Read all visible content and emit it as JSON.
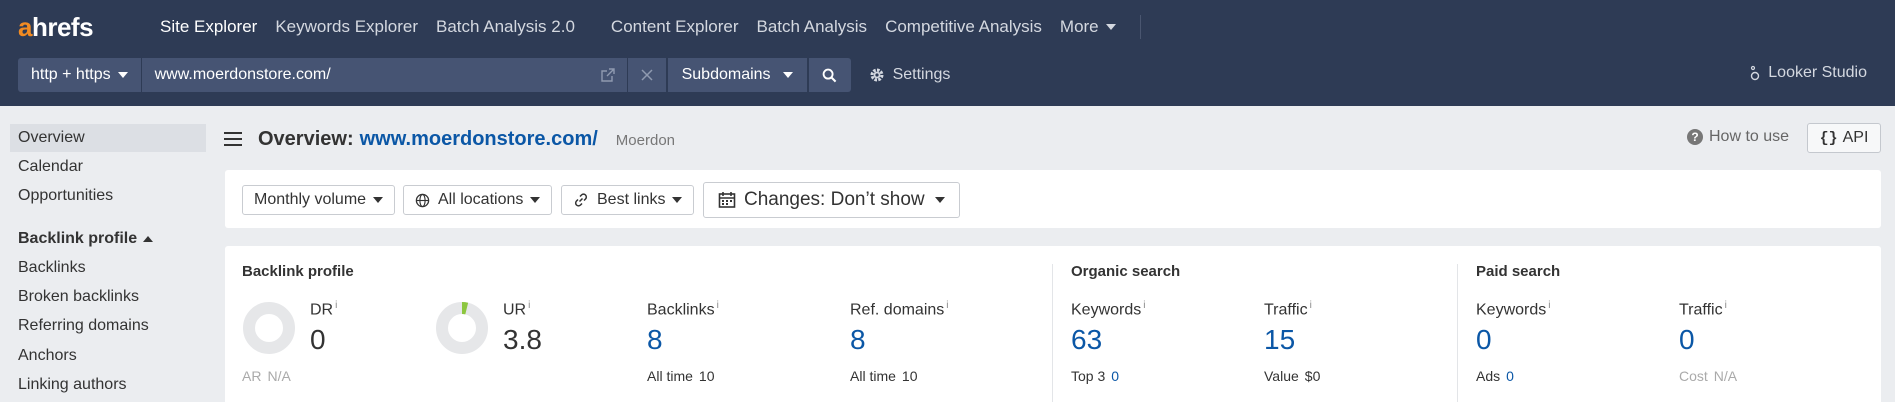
{
  "logo": {
    "a": "a",
    "rest": "hrefs"
  },
  "nav": {
    "items": [
      "Site Explorer",
      "Keywords Explorer",
      "Batch Analysis 2.0",
      "Content Explorer",
      "Batch Analysis",
      "Competitive Analysis"
    ],
    "more": "More"
  },
  "search": {
    "protocol": "http + https",
    "url": "www.moerdonstore.com/",
    "mode": "Subdomains",
    "settings": "Settings"
  },
  "looker": "Looker Studio",
  "sidebar": {
    "top_items": [
      "Overview",
      "Calendar",
      "Opportunities"
    ],
    "section": "Backlink profile",
    "section_items": [
      "Backlinks",
      "Broken backlinks",
      "Referring domains",
      "Anchors",
      "Linking authors"
    ]
  },
  "page": {
    "title": "Overview:",
    "domain": "www.moerdonstore.com/",
    "name": "Moerdon",
    "how_to_use": "How to use",
    "api": "API"
  },
  "filters": {
    "volume": "Monthly volume",
    "locations": "All locations",
    "links": "Best links",
    "changes": "Changes: Don’t show"
  },
  "metrics": {
    "backlink_profile": {
      "title": "Backlink profile",
      "dr": {
        "label": "DR",
        "value": "0",
        "sub_label": "AR",
        "sub_value": "N/A",
        "ring_fraction": 0
      },
      "ur": {
        "label": "UR",
        "value": "3.8",
        "ring_fraction": 0.038
      },
      "backlinks": {
        "label": "Backlinks",
        "value": "8",
        "sub_label": "All time",
        "sub_value": "10"
      },
      "ref_domains": {
        "label": "Ref. domains",
        "value": "8",
        "sub_label": "All time",
        "sub_value": "10"
      }
    },
    "organic": {
      "title": "Organic search",
      "keywords": {
        "label": "Keywords",
        "value": "63",
        "sub_label": "Top 3",
        "sub_value": "0"
      },
      "traffic": {
        "label": "Traffic",
        "value": "15",
        "sub_label": "Value",
        "sub_value": "$0"
      }
    },
    "paid": {
      "title": "Paid search",
      "keywords": {
        "label": "Keywords",
        "value": "0",
        "sub_label": "Ads",
        "sub_value": "0"
      },
      "traffic": {
        "label": "Traffic",
        "value": "0",
        "sub_label": "Cost",
        "sub_value": "N/A"
      }
    },
    "info_mark": "i"
  },
  "colors": {
    "nav_bg": "#2e3b55",
    "accent": "#f28b22",
    "link": "#0b57a6",
    "ur_ring": "#8cc63f"
  }
}
